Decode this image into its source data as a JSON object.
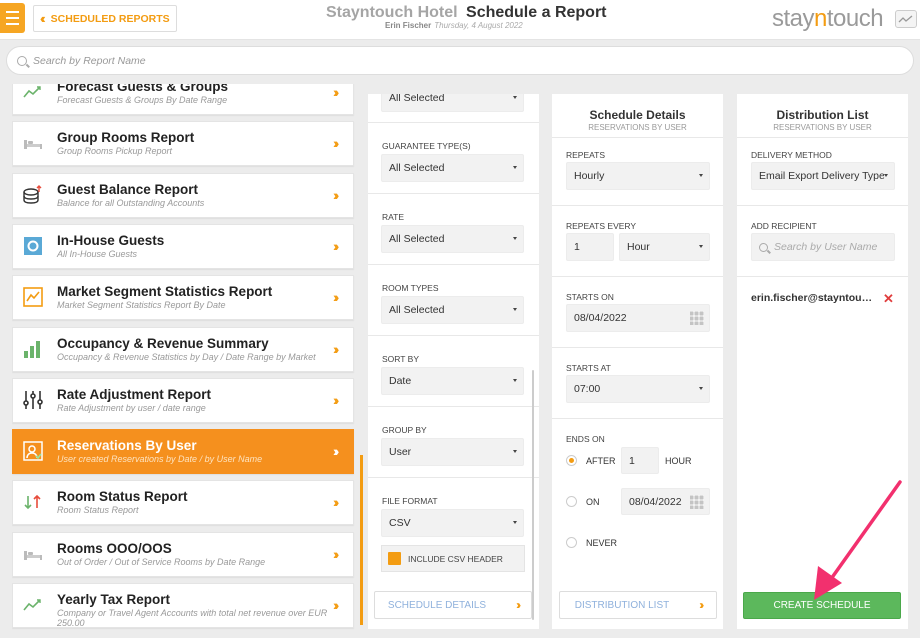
{
  "header": {
    "back_label": "SCHEDULED REPORTS",
    "hotel_name": "Stayntouch Hotel",
    "page_title": "Schedule a Report",
    "user_name": "Erin Fischer",
    "date": "Thursday, 4 August 2022",
    "logo_left": "stay",
    "logo_mid": "n",
    "logo_right": "touch"
  },
  "search": {
    "placeholder": "Search by Report Name"
  },
  "reports": [
    {
      "title": "Forecast Guests & Groups",
      "subtitle": "Forecast Guests & Groups By Date Range",
      "icon": "trend-icon"
    },
    {
      "title": "Group Rooms Report",
      "subtitle": "Group Rooms Pickup Report",
      "icon": "bed-icon"
    },
    {
      "title": "Guest Balance Report",
      "subtitle": "Balance for all Outstanding Accounts",
      "icon": "coins-icon"
    },
    {
      "title": "In-House Guests",
      "subtitle": "All In-House Guests",
      "icon": "inhouse-icon"
    },
    {
      "title": "Market Segment Statistics Report",
      "subtitle": "Market Segment Statistics Report By Date",
      "icon": "line-chart-icon"
    },
    {
      "title": "Occupancy & Revenue Summary",
      "subtitle": "Occupancy & Revenue Statistics by Day / Date Range by Market",
      "icon": "bar-chart-icon"
    },
    {
      "title": "Rate Adjustment Report",
      "subtitle": "Rate Adjustment by user / date range",
      "icon": "sliders-icon"
    },
    {
      "title": "Reservations By User",
      "subtitle": "User created Reservations by Date / by User Name",
      "icon": "user-card-icon",
      "active": true
    },
    {
      "title": "Room Status Report",
      "subtitle": "Room Status Report",
      "icon": "updown-arrows-icon"
    },
    {
      "title": "Rooms OOO/OOS",
      "subtitle": "Out of Order / Out of Service Rooms by Date Range",
      "icon": "bed-icon"
    },
    {
      "title": "Yearly Tax Report",
      "subtitle": "Company or Travel Agent Accounts with total net revenue over EUR 250.00",
      "icon": "trend-icon"
    }
  ],
  "filters": {
    "top_value": "All Selected",
    "guarantee_label": "GUARANTEE TYPE(S)",
    "guarantee_value": "All Selected",
    "rate_label": "RATE",
    "rate_value": "All Selected",
    "room_types_label": "ROOM TYPES",
    "room_types_value": "All Selected",
    "sort_label": "SORT BY",
    "sort_value": "Date",
    "group_label": "GROUP BY",
    "group_value": "User",
    "format_label": "FILE FORMAT",
    "format_value": "CSV",
    "csv_header_label": "INCLUDE CSV HEADER",
    "schedule_details_btn": "SCHEDULE DETAILS"
  },
  "schedule": {
    "title": "Schedule Details",
    "subtitle": "RESERVATIONS BY USER",
    "repeats_label": "REPEATS",
    "repeats_value": "Hourly",
    "every_label": "REPEATS EVERY",
    "every_value": "1",
    "every_unit": "Hour",
    "starts_on_label": "STARTS ON",
    "starts_on_value": "08/04/2022",
    "starts_at_label": "STARTS AT",
    "starts_at_value": "07:00",
    "ends_on_label": "ENDS ON",
    "after_label": "AFTER",
    "after_value": "1",
    "hour_label": "HOUR",
    "on_label": "ON",
    "on_value": "08/04/2022",
    "never_label": "NEVER",
    "distribution_btn": "DISTRIBUTION LIST"
  },
  "distribution": {
    "title": "Distribution List",
    "subtitle": "RESERVATIONS BY USER",
    "method_label": "DELIVERY METHOD",
    "method_value": "Email Export Delivery Type",
    "recipient_label": "ADD RECIPIENT",
    "recipient_placeholder": "Search by User Name",
    "recipient": "erin.fischer@stayntou…",
    "remove": "✕",
    "create_btn": "CREATE SCHEDULE"
  },
  "colors": {
    "accent": "#f39c12",
    "create": "#5cb85c",
    "annotation_arrow": "#f2306e"
  }
}
